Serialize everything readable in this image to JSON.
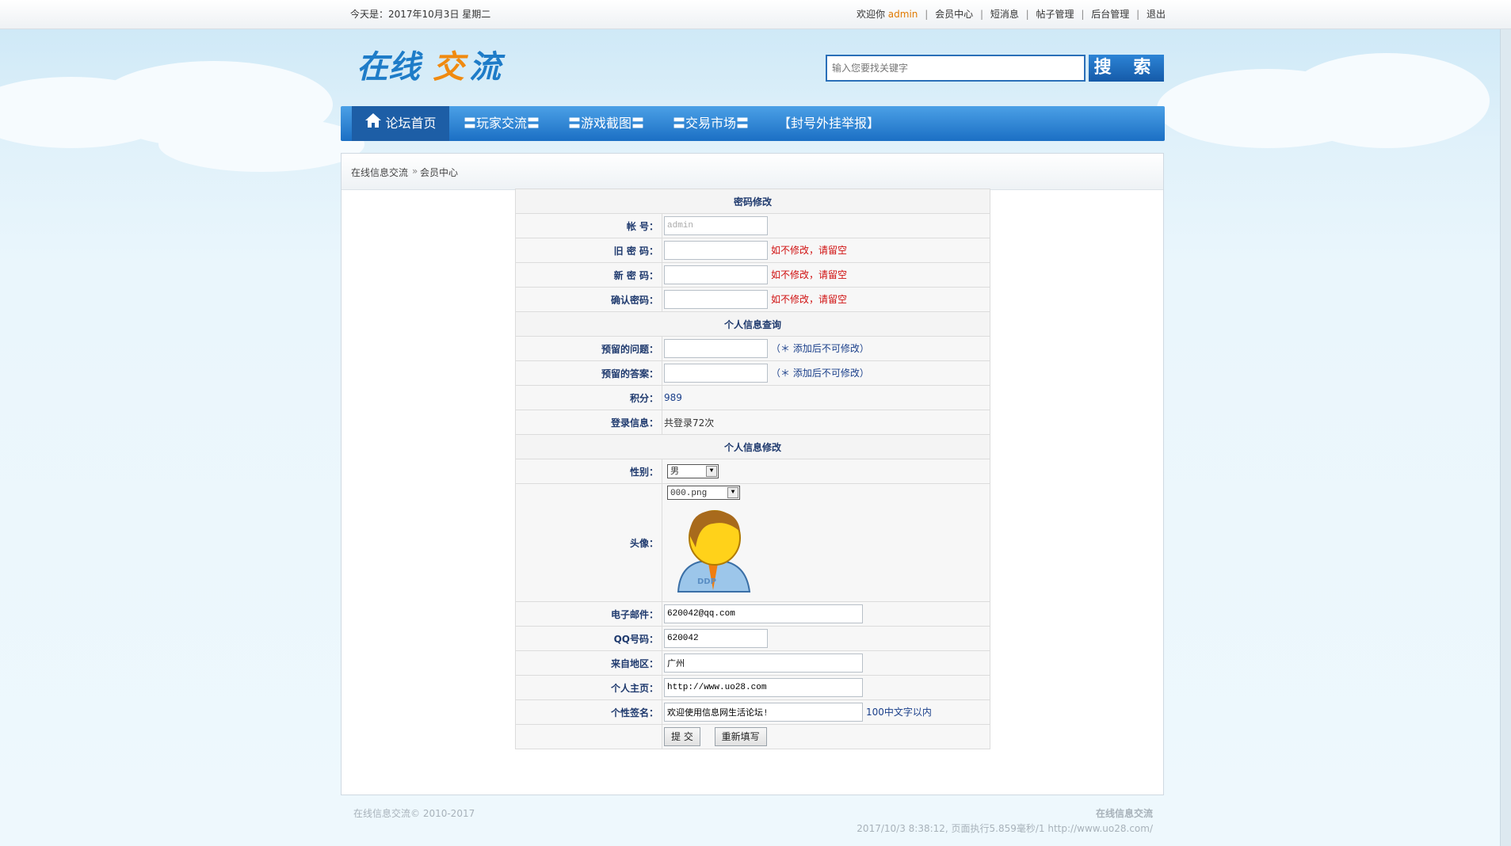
{
  "topbar": {
    "date": "今天是：2017年10月3日 星期二",
    "welcome": "欢迎你",
    "username": "admin",
    "links": [
      "会员中心",
      "短消息",
      "帖子管理",
      "后台管理",
      "退出"
    ]
  },
  "header": {
    "logo_text": "在线交流",
    "search_placeholder": "输入您要找关键字",
    "search_button": "搜 索"
  },
  "nav": {
    "items": [
      "论坛首页",
      "〓玩家交流〓",
      "〓游戏截图〓",
      "〓交易市场〓",
      "【封号外挂举报】"
    ]
  },
  "breadcrumb": {
    "home": "在线信息交流",
    "sep": "»",
    "current": "会员中心"
  },
  "form": {
    "section_password": "密码修改",
    "account_label": "帐 号：",
    "account_value": "admin",
    "old_password_label": "旧 密 码：",
    "new_password_label": "新 密 码：",
    "confirm_password_label": "确认密码：",
    "leave_blank_note": "如不修改，请留空",
    "section_query": "个人信息查询",
    "question_label": "预留的问题：",
    "answer_label": "预留的答案：",
    "immutable_note": "（＊ 添加后不可修改）",
    "points_label": "积分：",
    "points_value": "989",
    "login_label": "登录信息：",
    "login_value": "共登录72次",
    "section_edit": "个人信息修改",
    "gender_label": "性别：",
    "gender_value": "男",
    "avatar_label": "头像：",
    "avatar_value": "000.png",
    "email_label": "电子邮件：",
    "email_value": "620042@qq.com",
    "qq_label": "QQ号码：",
    "qq_value": "620042",
    "region_label": "来自地区：",
    "region_value": "广州",
    "homepage_label": "个人主页：",
    "homepage_value": "http://www.uo28.com",
    "signature_label": "个性签名：",
    "signature_value": "欢迎使用信息网生活论坛!",
    "signature_note": "100中文字以内",
    "submit_button": "提  交",
    "reset_button": "重新填写"
  },
  "footer": {
    "copyright": "在线信息交流© 2010-2017",
    "site_name": "在线信息交流",
    "stats": "2017/10/3 8:38:12, 页面执行5.859毫秒/1 http://www.uo28.com/"
  }
}
